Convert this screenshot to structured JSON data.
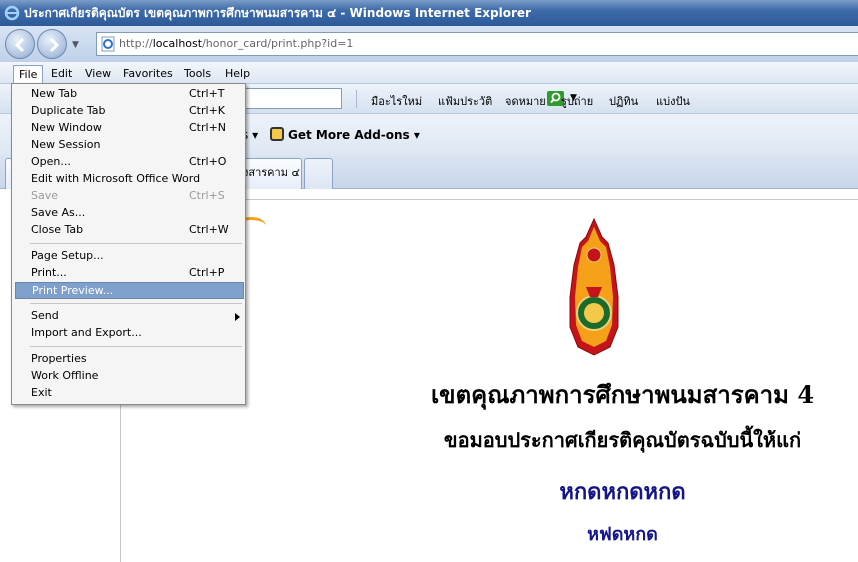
{
  "window": {
    "title": "ประกาศเกียรติคุณบัตร เขตคุณภาพการศึกษาพนมสารคาม ๔ - Windows Internet Explorer"
  },
  "address": {
    "prefix": "http://",
    "host": "localhost",
    "path": "/honor_card/print.php?id=1"
  },
  "menubar": {
    "items": [
      "File",
      "Edit",
      "View",
      "Favorites",
      "Tools",
      "Help"
    ],
    "active": "File"
  },
  "links": [
    "มือะไรใหม่",
    "แฟ้มประวัติ",
    "จดหมาย",
    "รูปถ่าย",
    "ปฏิทิน",
    "แบ่งปัน"
  ],
  "favorites": {
    "partial": "s",
    "get_more_addons": "Get More Add-ons"
  },
  "tab": {
    "title_partial": "งสารคาม ๔"
  },
  "file_menu": {
    "items": [
      {
        "label": "New Tab",
        "shortcut": "Ctrl+T"
      },
      {
        "label": "Duplicate Tab",
        "shortcut": "Ctrl+K"
      },
      {
        "label": "New Window",
        "shortcut": "Ctrl+N"
      },
      {
        "label": "New Session",
        "shortcut": ""
      },
      {
        "label": "Open...",
        "shortcut": "Ctrl+O"
      },
      {
        "label": "Edit with Microsoft Office Word",
        "shortcut": ""
      },
      {
        "label": "Save",
        "shortcut": "Ctrl+S",
        "disabled": true
      },
      {
        "label": "Save As...",
        "shortcut": ""
      },
      {
        "label": "Close Tab",
        "shortcut": "Ctrl+W"
      },
      {
        "label": "Page Setup...",
        "shortcut": ""
      },
      {
        "label": "Print...",
        "shortcut": "Ctrl+P"
      },
      {
        "label": "Print Preview...",
        "shortcut": "",
        "highlighted": true
      },
      {
        "label": "Send",
        "shortcut": "",
        "submenu": true
      },
      {
        "label": "Import and Export...",
        "shortcut": ""
      },
      {
        "label": "Properties",
        "shortcut": ""
      },
      {
        "label": "Work Offline",
        "shortcut": ""
      },
      {
        "label": "Exit",
        "shortcut": ""
      }
    ]
  },
  "document": {
    "org_name": "เขตคุณภาพการศึกษาพนมสารคาม 4",
    "presentation": "ขอมอบประกาศเกียรติคุณบัตรฉบับนี้ให้แก่",
    "recipient": "หกดหกดหกด",
    "detail": "หฟดหกด"
  },
  "colors": {
    "highlight": "#7fa0cb",
    "recipient_text": "#14148c",
    "seal_orange": "#f4a018"
  }
}
